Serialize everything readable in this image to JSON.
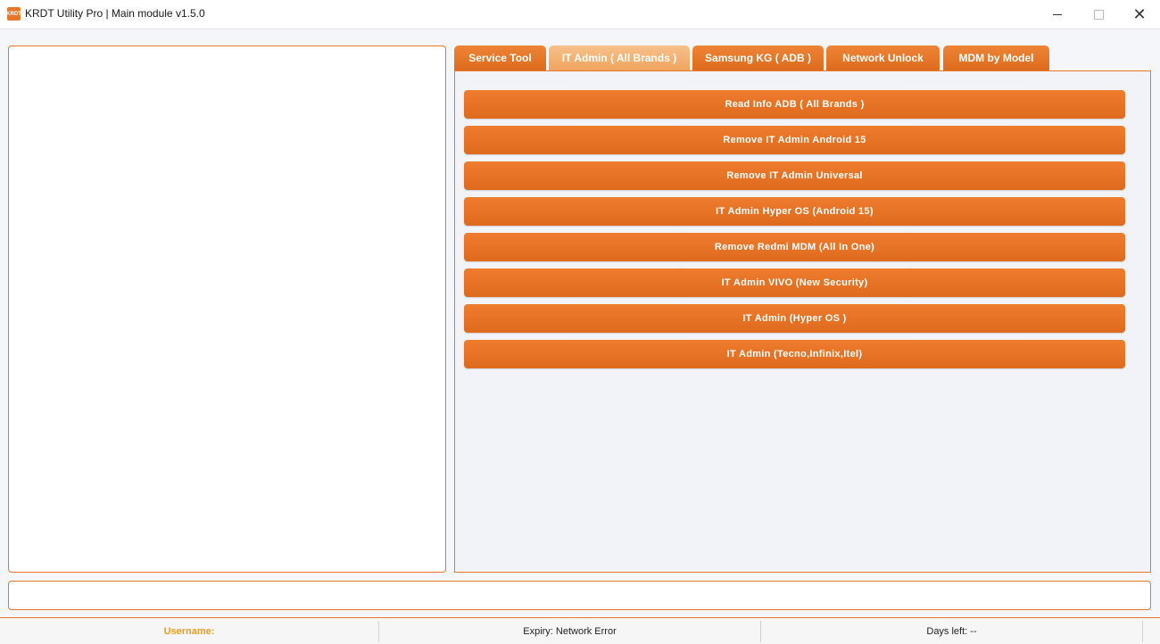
{
  "window": {
    "title": "KRDT Utility Pro | Main module  v1.5.0",
    "icon_text": "KRDT",
    "controls": {
      "minimize": "–",
      "maximize": "□",
      "close": "✕"
    }
  },
  "tabs": [
    {
      "label": "Service Tool",
      "active": false
    },
    {
      "label": "IT Admin ( All Brands )",
      "active": true
    },
    {
      "label": "Samsung KG ( ADB )",
      "active": false
    },
    {
      "label": "Network Unlock",
      "active": false
    },
    {
      "label": "MDM by Model",
      "active": false
    }
  ],
  "actions": [
    "Read Info ADB ( All Brands )",
    "Remove IT Admin Android 15",
    "Remove IT Admin Universal",
    "IT Admin Hyper OS (Android 15)",
    "Remove  Redmi MDM (All In One)",
    "IT Admin VIVO (New Security)",
    "IT Admin (Hyper OS )",
    "IT Admin (Tecno,Infinix,Itel)"
  ],
  "status": {
    "username_label": "Username:",
    "expiry": "Expiry: Network Error",
    "days_left": "Days left: --"
  },
  "colors": {
    "accent": "#e8772a",
    "active_tab": "#f2ad6a",
    "username": "#f29b1b"
  }
}
